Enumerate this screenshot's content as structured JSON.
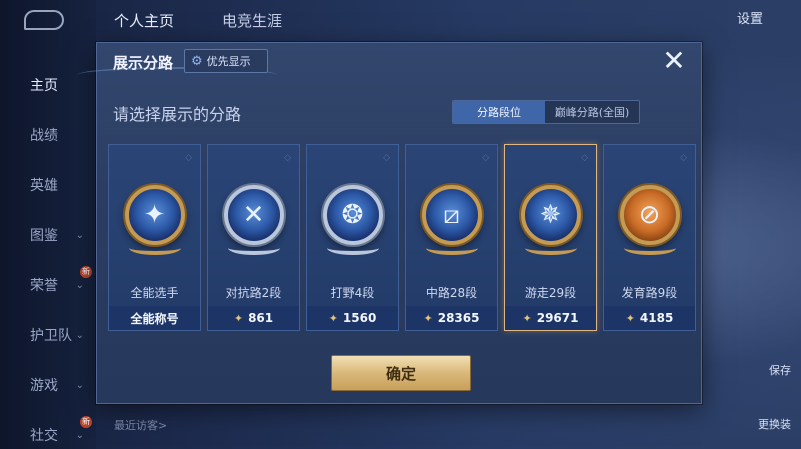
{
  "background": {
    "top_tabs": [
      "个人主页",
      "电竞生涯"
    ],
    "settings_label": "设置",
    "side_nav": [
      {
        "label": "主页",
        "chevron": false,
        "new_badge": false
      },
      {
        "label": "战绩",
        "chevron": false,
        "new_badge": false
      },
      {
        "label": "英雄",
        "chevron": false,
        "new_badge": false
      },
      {
        "label": "图鉴",
        "chevron": true,
        "new_badge": false
      },
      {
        "label": "荣誉",
        "chevron": true,
        "new_badge": true
      },
      {
        "label": "护卫队",
        "chevron": true,
        "new_badge": false
      },
      {
        "label": "游戏",
        "chevron": true,
        "new_badge": false
      },
      {
        "label": "社交",
        "chevron": true,
        "new_badge": true
      }
    ],
    "new_badge_text": "新",
    "recent_visitors_label": "最近访客>",
    "right_labels": [
      "保存",
      "更换装"
    ]
  },
  "dialog": {
    "title": "展示分路",
    "priority_button": "优先显示",
    "close_symbol": "✕",
    "subtitle": "请选择展示的分路",
    "segments": {
      "active": "分路段位",
      "inactive": "巅峰分路(全国)"
    },
    "confirm_label": "确定",
    "cards": [
      {
        "role": "全能选手",
        "footer": "全能称号",
        "score": "",
        "emblem": "gold",
        "symbol": "✦",
        "selected": false
      },
      {
        "role": "对抗路2段",
        "footer": "",
        "score": "861",
        "emblem": "silver",
        "symbol": "✕",
        "selected": false
      },
      {
        "role": "打野4段",
        "footer": "",
        "score": "1560",
        "emblem": "silver",
        "symbol": "❂",
        "selected": false
      },
      {
        "role": "中路28段",
        "footer": "",
        "score": "28365",
        "emblem": "gold",
        "symbol": "⧄",
        "selected": false
      },
      {
        "role": "游走29段",
        "footer": "",
        "score": "29671",
        "emblem": "gold",
        "symbol": "✵",
        "selected": true
      },
      {
        "role": "发育路9段",
        "footer": "",
        "score": "4185",
        "emblem": "orange",
        "symbol": "⊘",
        "selected": false
      }
    ]
  },
  "colors": {
    "dialog_bg": "#2b3d62",
    "accent_blue": "#3f66a8",
    "gold": "#c59a52",
    "selected_border": "#e0b783",
    "confirm_gold": "#d9b87a"
  }
}
